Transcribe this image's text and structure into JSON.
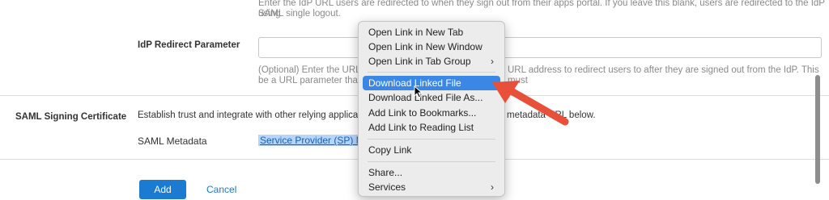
{
  "top_help": {
    "line1": "Enter the IdP URL users are redirected to when they sign out from their apps portal. If you leave this blank, users are redirected to the IdP using",
    "line2": "SAML single logout."
  },
  "idp_redirect": {
    "label": "IdP Redirect Parameter",
    "input_value": "",
    "help_line1_left": "(Optional) Enter the URL p",
    "help_line1_right": "URL address to redirect users to after they are signed out from the IdP. This must",
    "help_line2_left": "be a URL parameter that"
  },
  "signing_cert": {
    "label": "SAML Signing Certificate",
    "desc_left": "Establish trust and integrate with other relying applicatio",
    "desc_right": "metadata URL below.",
    "metadata_label": "SAML Metadata",
    "metadata_link": "Service Provider (SP) M"
  },
  "actions": {
    "add": "Add",
    "cancel": "Cancel"
  },
  "context_menu": {
    "items": [
      {
        "label": "Open Link in New Tab",
        "submenu": false
      },
      {
        "label": "Open Link in New Window",
        "submenu": false
      },
      {
        "label": "Open Link in Tab Group",
        "submenu": true
      },
      {
        "label": "Download Linked File",
        "submenu": false,
        "highlighted": true
      },
      {
        "label": "Download Linked File As...",
        "submenu": false
      },
      {
        "label": "Add Link to Bookmarks...",
        "submenu": false
      },
      {
        "label": "Add Link to Reading List",
        "submenu": false
      },
      {
        "label": "Copy Link",
        "submenu": false
      },
      {
        "label": "Share...",
        "submenu": false
      },
      {
        "label": "Services",
        "submenu": true
      }
    ],
    "submenu_glyph": "›"
  },
  "colors": {
    "highlight": "#3b87e6",
    "annotation_arrow": "#e8503a",
    "primary_button": "#1b7ad1"
  }
}
